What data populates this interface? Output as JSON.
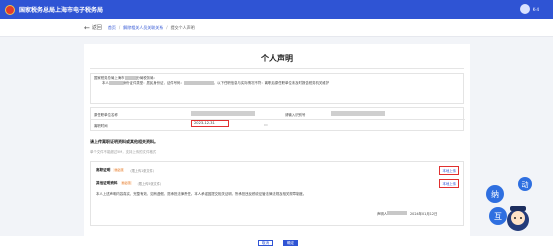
{
  "header": {
    "site_title": "国家税务总局上海市电子税务局",
    "user_name": "K-4"
  },
  "nav": {
    "back_label": "返回",
    "breadcrumbs": [
      "首页",
      "解除相关人员关联关系",
      "提交个人声明"
    ]
  },
  "declaration_card": {
    "title": "个人声明",
    "notice_line1": "国家税务总局上海市",
    "notice_line1_b": "分局税务局：",
    "notice_line2_a": "本人",
    "notice_line2_b": "身份证件类型：",
    "notice_line2_c": "居民身份证，证件号码：",
    "notice_line2_d": "，以下任职信息与实际情况不符：离职后原任职单位未及时报告税务机关维护"
  },
  "form": {
    "employer_label": "原任职单位名称",
    "tax_id_label": "请输入识别号",
    "leave_date_label": "离职时间",
    "leave_date_value": "2023-12-31"
  },
  "attachments": {
    "section_title": "请上传离职证明资料或其他相关资料。",
    "section_hint": "单个文件不能超过5M，支持上传的文件格式",
    "rows": [
      {
        "label": "离职证明",
        "tag": "非必须",
        "hint": "（限上传1张文件）",
        "upload_label": "本地上传"
      },
      {
        "label": "其他证明资料",
        "tag": "非必须",
        "hint": "（限上传5张文件）",
        "upload_label": "本地上传"
      }
    ],
    "declaration_text": "本人上述声明内容真实、完整有效，如有虚假，愿承担法律责任。本人承诺因提交相关证明，所承担违反税收征管法律法规及相关规章制度。",
    "sign_label": "声明人:",
    "sign_date": "2024年01月12日"
  },
  "footer": {
    "cancel_label": "取消",
    "confirm_label": "确定"
  },
  "mascot": {
    "text_left": "纳",
    "text_mid": "互",
    "text_right": "动"
  },
  "colors": {
    "brand_blue": "#2f54d4",
    "highlight_red": "#e03030",
    "tag_orange": "#e0782b"
  }
}
